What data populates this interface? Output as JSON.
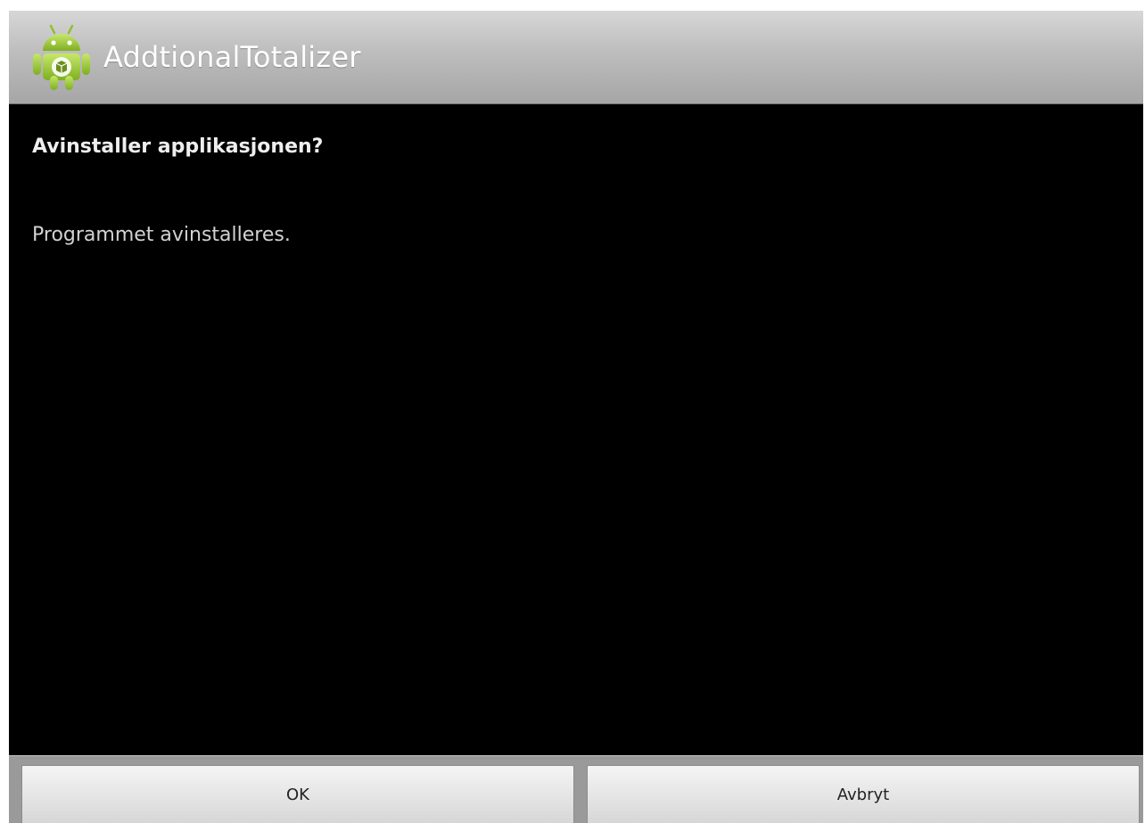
{
  "app": {
    "title": "AddtionalTotalizer",
    "icon": "android-app-icon"
  },
  "dialog": {
    "title": "Avinstaller applikasjonen?",
    "message": "Programmet avinstalleres."
  },
  "buttons": {
    "ok_label": "OK",
    "cancel_label": "Avbryt"
  },
  "colors": {
    "android_green": "#9fcd3a",
    "background": "#000000",
    "titlebar": "#bdbdbd"
  }
}
